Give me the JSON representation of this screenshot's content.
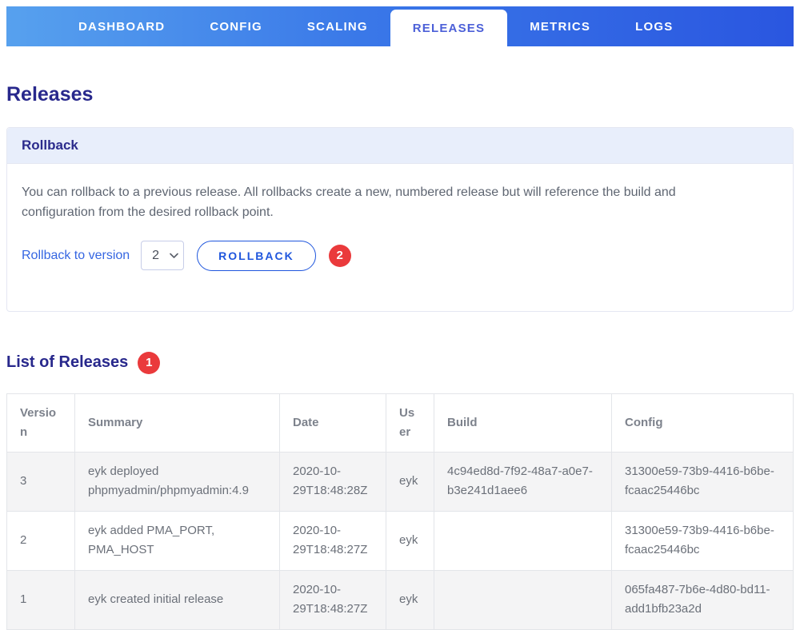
{
  "nav": {
    "tabs": [
      {
        "label": "DASHBOARD",
        "active": false
      },
      {
        "label": "CONFIG",
        "active": false
      },
      {
        "label": "SCALING",
        "active": false
      },
      {
        "label": "RELEASES",
        "active": true
      },
      {
        "label": "METRICS",
        "active": false
      },
      {
        "label": "LOGS",
        "active": false
      }
    ]
  },
  "page": {
    "title": "Releases"
  },
  "rollback": {
    "panel_title": "Rollback",
    "description": "You can rollback to a previous release. All rollbacks create a new, numbered release but will reference the build and configuration from the desired rollback point.",
    "label": "Rollback to version",
    "selected_version": "2",
    "button_label": "ROLLBACK",
    "step_badge": "2"
  },
  "releases": {
    "title": "List of Releases",
    "step_badge": "1",
    "table": {
      "headers": [
        "Version",
        "Summary",
        "Date",
        "User",
        "Build",
        "Config"
      ],
      "rows": [
        {
          "version": "3",
          "summary": "eyk deployed phpmyadmin/phpmyadmin:4.9",
          "date": "2020-10-29T18:48:28Z",
          "user": "eyk",
          "build": "4c94ed8d-7f92-48a7-a0e7-b3e241d1aee6",
          "config": "31300e59-73b9-4416-b6be-fcaac25446bc"
        },
        {
          "version": "2",
          "summary": "eyk added PMA_PORT, PMA_HOST",
          "date": "2020-10-29T18:48:27Z",
          "user": "eyk",
          "build": "",
          "config": "31300e59-73b9-4416-b6be-fcaac25446bc"
        },
        {
          "version": "1",
          "summary": "eyk created initial release",
          "date": "2020-10-29T18:48:27Z",
          "user": "eyk",
          "build": "",
          "config": "065fa487-7b6e-4d80-bd11-add1bfb23a2d"
        }
      ]
    }
  },
  "colors": {
    "nav_gradient_start": "#57a1ee",
    "nav_gradient_end": "#2a56e0",
    "active_tab_text": "#4c60d8",
    "heading_indigo": "#28288c",
    "panel_header_bg": "#e8eefb",
    "body_text_grey": "#5f6672",
    "link_blue": "#3566e2",
    "button_blue": "#1f56dd",
    "badge_red": "#ea3a3c",
    "table_border": "#e3e5e9",
    "table_header_text": "#7d828c",
    "table_cell_text": "#6b7079",
    "stripe_bg": "#f4f4f5"
  }
}
